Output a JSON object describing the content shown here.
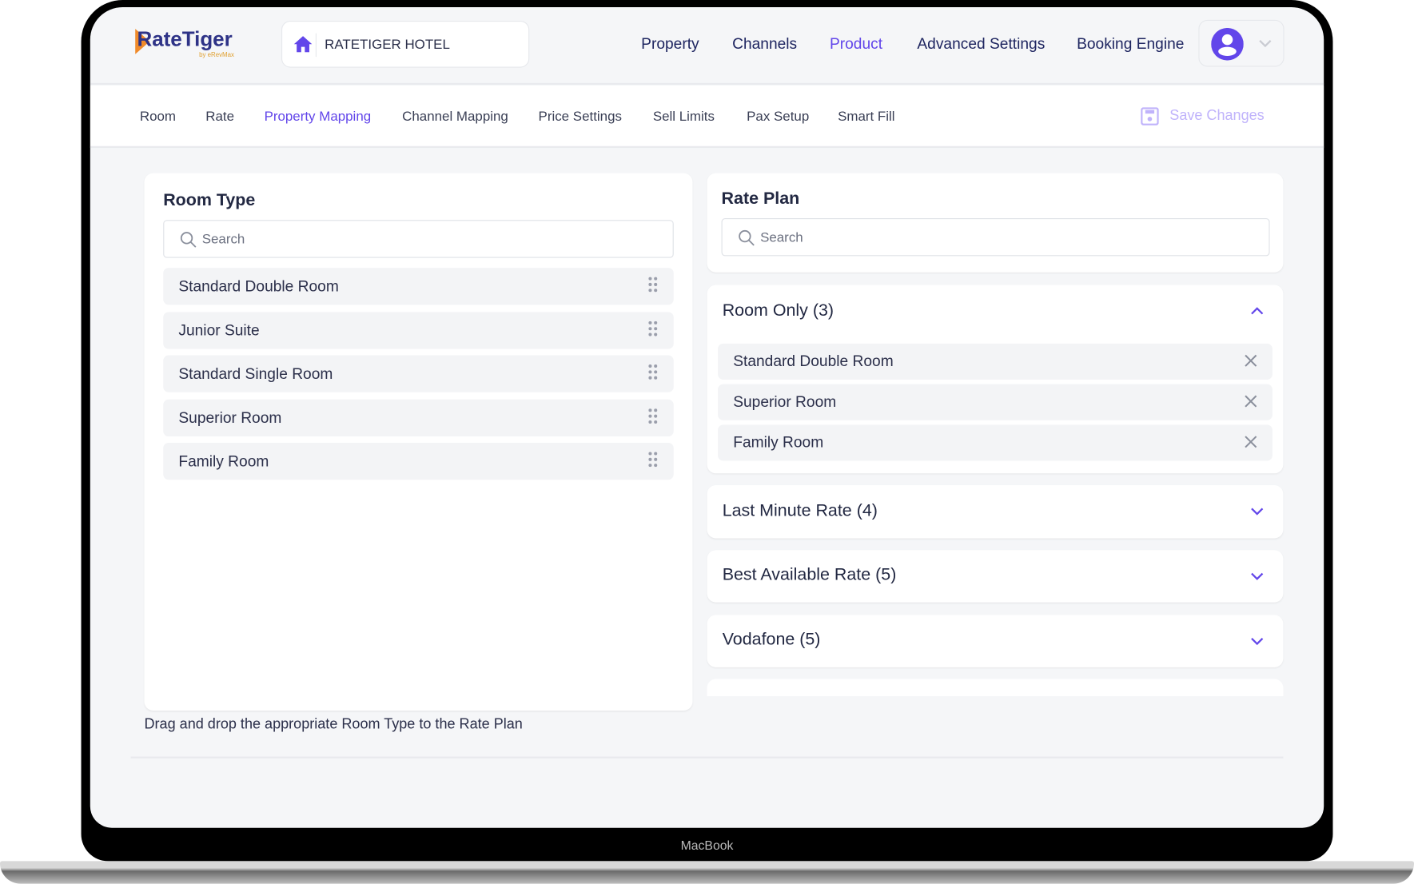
{
  "brand": {
    "logo_text": "RateTiger",
    "logo_sub": "by eRevMax"
  },
  "hotel": {
    "name": "RATETIGER HOTEL",
    "icon": "home-icon"
  },
  "top_nav": [
    {
      "label": "Property",
      "active": false
    },
    {
      "label": "Channels",
      "active": false
    },
    {
      "label": "Product",
      "active": true
    },
    {
      "label": "Advanced Settings",
      "active": false
    },
    {
      "label": "Booking Engine",
      "active": false
    }
  ],
  "sub_nav": [
    {
      "label": "Room",
      "active": false
    },
    {
      "label": "Rate",
      "active": false
    },
    {
      "label": "Property Mapping",
      "active": true
    },
    {
      "label": "Channel Mapping",
      "active": false
    },
    {
      "label": "Price Settings",
      "active": false
    },
    {
      "label": "Sell Limits",
      "active": false
    },
    {
      "label": "Pax Setup",
      "active": false
    },
    {
      "label": "Smart Fill",
      "active": false
    }
  ],
  "save_label": "Save Changes",
  "room_type": {
    "title": "Room Type",
    "search_placeholder": "Search",
    "items": [
      "Standard Double Room",
      "Junior Suite",
      "Standard Single Room",
      "Superior Room",
      "Family Room"
    ]
  },
  "rate_plan": {
    "title": "Rate Plan",
    "search_placeholder": "Search",
    "groups": [
      {
        "title": "Room Only (3)",
        "expanded": true,
        "rooms": [
          "Standard Double Room",
          "Superior Room",
          "Family Room"
        ]
      },
      {
        "title": "Last Minute Rate (4)",
        "expanded": false
      },
      {
        "title": "Best Available Rate (5)",
        "expanded": false
      },
      {
        "title": "Vodafone (5)",
        "expanded": false
      }
    ]
  },
  "hint": "Drag and drop the appropriate Room Type to the Rate Plan",
  "device_label": "MacBook",
  "colors": {
    "accent": "#6246ea",
    "nav_text": "#1e2560",
    "save_disabled": "#c0b3fb"
  }
}
